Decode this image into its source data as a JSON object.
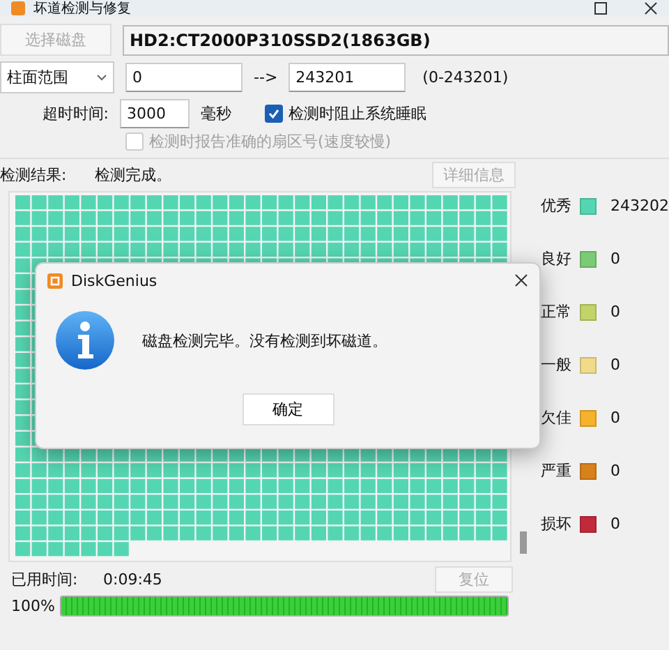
{
  "window": {
    "title": "坏道检测与修复"
  },
  "disk": {
    "button": {
      "label": "选择磁盘",
      "disabled": true
    },
    "name": "HD2:CT2000P310SSD2(1863GB)"
  },
  "range": {
    "mode": "柱面范围",
    "from": "0",
    "arrow": "-->",
    "to": "243201",
    "hint": "(0-243201)"
  },
  "timeout": {
    "label": "超时时间:",
    "value": "3000",
    "unit": "毫秒"
  },
  "options": [
    {
      "label": "检测时阻止系统睡眠",
      "checked": true,
      "disabled": false
    },
    {
      "label": "检测时报告准确的扇区号(速度较慢)",
      "checked": false,
      "disabled": true
    }
  ],
  "result": {
    "label": "检测结果:",
    "value": "检测完成。",
    "details_button": {
      "label": "详细信息",
      "disabled": true
    }
  },
  "legend": [
    {
      "label": "优秀",
      "color": "#55d6b2",
      "count": "243202"
    },
    {
      "label": "良好",
      "color": "#7acb74",
      "count": "0"
    },
    {
      "label": "正常",
      "color": "#c2d468",
      "count": "0"
    },
    {
      "label": "一般",
      "color": "#f1da8a",
      "count": "0"
    },
    {
      "label": "欠佳",
      "color": "#f5b22b",
      "count": "0"
    },
    {
      "label": "严重",
      "color": "#d8801a",
      "count": "0"
    },
    {
      "label": "损坏",
      "color": "#c12a3c",
      "count": "0"
    }
  ],
  "elapsed": {
    "label": "已用时间:",
    "value": "0:09:45"
  },
  "reset_button": {
    "label": "复位",
    "disabled": true
  },
  "progress": {
    "reading": "100%",
    "level": 1
  },
  "dialog": {
    "title": "DiskGenius",
    "message": "磁盘检测完毕。没有检测到坏磁道。",
    "ok_button": "确定"
  }
}
